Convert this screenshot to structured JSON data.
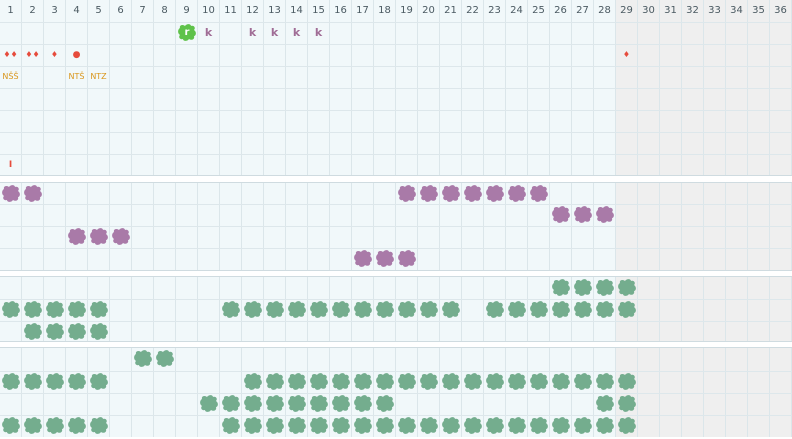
{
  "calendar": {
    "days": [
      "1",
      "2",
      "3",
      "4",
      "5",
      "6",
      "7",
      "8",
      "9",
      "10",
      "11",
      "12",
      "13",
      "14",
      "15",
      "16",
      "17",
      "18",
      "19",
      "20",
      "21",
      "22",
      "23",
      "24",
      "25",
      "26",
      "27",
      "28",
      "29",
      "30",
      "31",
      "32",
      "33",
      "34",
      "35",
      "36"
    ],
    "active_day_count": 28,
    "colors": {
      "active_cell": "#f1f8fa",
      "inactive_cell": "#efefef",
      "grid_line": "#dbe6ea",
      "purple_blob": "#a97aa8",
      "green_blob": "#74ad8e",
      "bright_green_blob": "#5fc24a",
      "drop_red": "#e64b3c",
      "code_orange": "#d9961c",
      "letter_k": "#a06d96"
    }
  },
  "top_section": {
    "marker_row": [
      {
        "day": 9,
        "type": "blob",
        "color": "bright_green",
        "text": "r"
      },
      {
        "day": 10,
        "type": "letter",
        "text": "k"
      },
      {
        "day": 12,
        "type": "letter",
        "text": "k"
      },
      {
        "day": 13,
        "type": "letter",
        "text": "k"
      },
      {
        "day": 14,
        "type": "letter",
        "text": "k"
      },
      {
        "day": 15,
        "type": "letter",
        "text": "k"
      }
    ],
    "drop_row": [
      {
        "day": 1,
        "icon": "double-drop-icon",
        "text": "♦♦"
      },
      {
        "day": 2,
        "icon": "double-drop-icon",
        "text": "♦♦"
      },
      {
        "day": 3,
        "icon": "drop-icon",
        "text": "♦"
      },
      {
        "day": 4,
        "icon": "dot-icon",
        "text": "●"
      },
      {
        "day": 29,
        "icon": "drop-icon",
        "text": "♦"
      }
    ],
    "code_row": [
      {
        "day": 1,
        "text": "NŠŠ"
      },
      {
        "day": 4,
        "text": "NTŠ"
      },
      {
        "day": 5,
        "text": "NTZ"
      }
    ],
    "bottom_mark": {
      "day": 1,
      "text": "I"
    }
  },
  "sections": [
    {
      "name": "purple",
      "color": "purple",
      "rows": [
        [
          1,
          2,
          19,
          20,
          21,
          22,
          23,
          24,
          25
        ],
        [
          26,
          27,
          28
        ],
        [
          4,
          5,
          6
        ],
        [
          17,
          18,
          19
        ]
      ]
    },
    {
      "name": "green-a",
      "color": "green",
      "rows": [
        [
          26,
          27,
          28,
          29
        ],
        [
          1,
          2,
          3,
          4,
          5,
          11,
          12,
          13,
          14,
          15,
          16,
          17,
          18,
          19,
          20,
          21,
          23,
          24,
          25,
          26,
          27,
          28,
          29
        ],
        [
          2,
          3,
          4,
          5
        ]
      ]
    },
    {
      "name": "green-b",
      "color": "green",
      "rows": [
        [
          7,
          8
        ],
        [
          1,
          2,
          3,
          4,
          5,
          12,
          13,
          14,
          15,
          16,
          17,
          18,
          19,
          20,
          21,
          22,
          23,
          24,
          25,
          26,
          27,
          28,
          29
        ],
        [
          10,
          11,
          12,
          13,
          14,
          15,
          16,
          17,
          18,
          28,
          29
        ],
        [
          1,
          2,
          3,
          4,
          5,
          11,
          12,
          13,
          14,
          15,
          16,
          17,
          18,
          19,
          20,
          21,
          22,
          23,
          24,
          25,
          26,
          27,
          28,
          29
        ]
      ]
    }
  ]
}
